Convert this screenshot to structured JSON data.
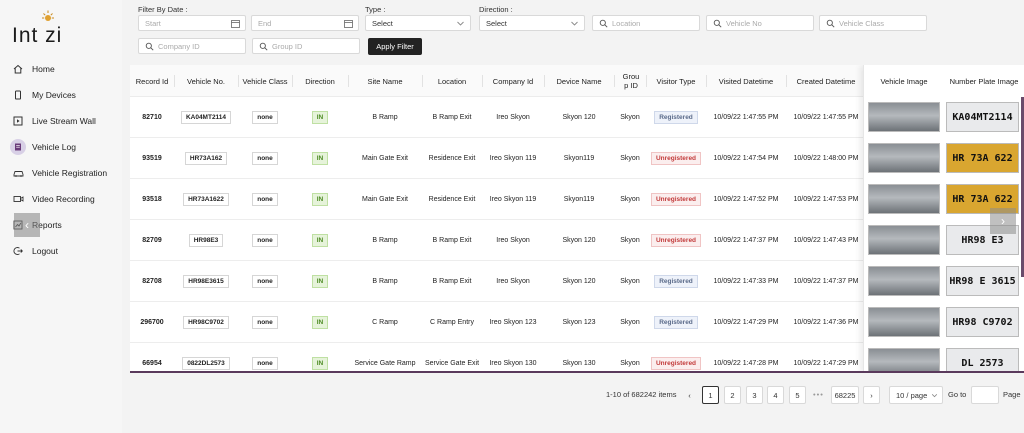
{
  "app": {
    "logo_text": "Int  zi"
  },
  "nav": [
    {
      "label": "Home",
      "icon": "home-icon"
    },
    {
      "label": "My Devices",
      "icon": "device-icon"
    },
    {
      "label": "Live Stream Wall",
      "icon": "stream-icon"
    },
    {
      "label": "Vehicle Log",
      "icon": "log-icon",
      "active": true
    },
    {
      "label": "Vehicle Registration",
      "icon": "car-icon"
    },
    {
      "label": "Video Recording",
      "icon": "video-icon"
    },
    {
      "label": "Reports",
      "icon": "report-icon"
    },
    {
      "label": "Logout",
      "icon": "logout-icon"
    }
  ],
  "filters": {
    "date_label": "Filter By Date :",
    "start_placeholder": "Start",
    "end_placeholder": "End",
    "type_label": "Type :",
    "type_value": "Select",
    "direction_label": "Direction :",
    "direction_value": "Select",
    "location_placeholder": "Location",
    "vehicle_no_placeholder": "Vehicle No",
    "vehicle_class_placeholder": "Vehicle Class",
    "company_id_placeholder": "Company ID",
    "group_id_placeholder": "Group ID",
    "apply_label": "Apply Filter"
  },
  "table": {
    "headers": {
      "record_id": "Record Id",
      "vehicle_no": "Vehicle No.",
      "vehicle_class": "Vehicle Class",
      "direction": "Direction",
      "site_name": "Site Name",
      "location": "Location",
      "company_id": "Company Id",
      "device_name": "Device Name",
      "group_id": "Grou p ID",
      "visitor_type": "Visitor Type",
      "visited_datetime": "Visited Datetime",
      "created_datetime": "Created Datetime",
      "vehicle_image": "Vehicle Image",
      "plate_image": "Number Plate Image"
    },
    "rows": [
      {
        "record_id": "82710",
        "vehicle_no": "KA04MT2114",
        "vehicle_class": "none",
        "direction": "IN",
        "site_name": "B Ramp",
        "location": "B Ramp Exit",
        "company_id": "Ireo Skyon",
        "device_name": "Skyon 120",
        "group_id": "Skyon",
        "visitor_type": "Registered",
        "visited": "10/09/22 1:47:55 PM",
        "created": "10/09/22 1:47:55 PM",
        "plate_text": "KA04MT2114",
        "plate_style": "white"
      },
      {
        "record_id": "93519",
        "vehicle_no": "HR73A162",
        "vehicle_class": "none",
        "direction": "IN",
        "site_name": "Main Gate Exit",
        "location": "Residence Exit",
        "company_id": "Ireo Skyon 119",
        "device_name": "Skyon119",
        "group_id": "Skyon",
        "visitor_type": "Unregistered",
        "visited": "10/09/22 1:47:54 PM",
        "created": "10/09/22 1:48:00 PM",
        "plate_text": "HR 73A 622",
        "plate_style": "yellow"
      },
      {
        "record_id": "93518",
        "vehicle_no": "HR73A1622",
        "vehicle_class": "none",
        "direction": "IN",
        "site_name": "Main Gate Exit",
        "location": "Residence Exit",
        "company_id": "Ireo Skyon 119",
        "device_name": "Skyon119",
        "group_id": "Skyon",
        "visitor_type": "Unregistered",
        "visited": "10/09/22 1:47:52 PM",
        "created": "10/09/22 1:47:53 PM",
        "plate_text": "HR 73A 622",
        "plate_style": "yellow"
      },
      {
        "record_id": "82709",
        "vehicle_no": "HR98E3",
        "vehicle_class": "none",
        "direction": "IN",
        "site_name": "B Ramp",
        "location": "B Ramp Exit",
        "company_id": "Ireo Skyon",
        "device_name": "Skyon 120",
        "group_id": "Skyon",
        "visitor_type": "Unregistered",
        "visited": "10/09/22 1:47:37 PM",
        "created": "10/09/22 1:47:43 PM",
        "plate_text": "HR98 E3",
        "plate_style": "white"
      },
      {
        "record_id": "82708",
        "vehicle_no": "HR98E3615",
        "vehicle_class": "none",
        "direction": "IN",
        "site_name": "B Ramp",
        "location": "B Ramp Exit",
        "company_id": "Ireo Skyon",
        "device_name": "Skyon 120",
        "group_id": "Skyon",
        "visitor_type": "Registered",
        "visited": "10/09/22 1:47:33 PM",
        "created": "10/09/22 1:47:37 PM",
        "plate_text": "HR98 E 3615",
        "plate_style": "white"
      },
      {
        "record_id": "296700",
        "vehicle_no": "HR98C9702",
        "vehicle_class": "none",
        "direction": "IN",
        "site_name": "C Ramp",
        "location": "C Ramp Entry",
        "company_id": "Ireo Skyon 123",
        "device_name": "Skyon 123",
        "group_id": "Skyon",
        "visitor_type": "Registered",
        "visited": "10/09/22 1:47:29 PM",
        "created": "10/09/22 1:47:36 PM",
        "plate_text": "HR98 C9702",
        "plate_style": "white"
      },
      {
        "record_id": "66954",
        "vehicle_no": "0822DL2573",
        "vehicle_class": "none",
        "direction": "IN",
        "site_name": "Service Gate Ramp",
        "location": "Service Gate Exit",
        "company_id": "Ireo Skyon 130",
        "device_name": "Skyon 130",
        "group_id": "Skyon",
        "visitor_type": "Unregistered",
        "visited": "10/09/22 1:47:28 PM",
        "created": "10/09/22 1:47:29 PM",
        "plate_text": "DL 2573",
        "plate_style": "white"
      }
    ]
  },
  "pagination": {
    "summary": "1-10 of 682242 items",
    "pages": [
      "1",
      "2",
      "3",
      "4",
      "5"
    ],
    "ellipsis": "•••",
    "last_page": "68225",
    "page_size": "10 / page",
    "goto_label": "Go to",
    "page_suffix": "Page"
  },
  "colors": {
    "accent_dark": "#222222",
    "scroll_accent": "#5a3a5c",
    "registered": "#5b6b8a",
    "unregistered": "#c23a3a",
    "in_tag": "#4c8a22"
  }
}
